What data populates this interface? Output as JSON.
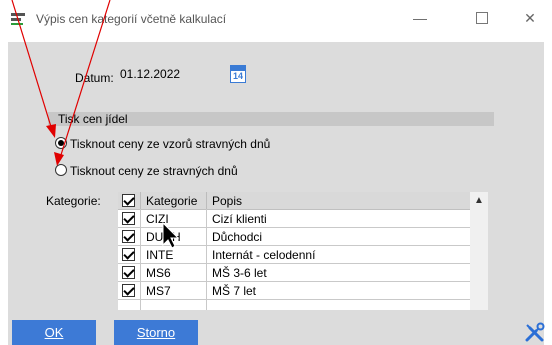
{
  "window": {
    "title": "Výpis cen kategorií včetně kalkulací",
    "minimize": "—",
    "close": "✕"
  },
  "form": {
    "date_label": "Datum:",
    "date_value": "01.12.2022",
    "calendar_icon_text": "14",
    "group_title": "Tisk cen jídel",
    "radio_options": [
      {
        "label": "Tisknout ceny ze vzorů stravných dnů",
        "selected": true
      },
      {
        "label": "Tisknout ceny ze stravných dnů",
        "selected": false
      }
    ],
    "categories_label": "Kategorie:"
  },
  "table": {
    "columns": [
      "Kategorie",
      "Popis"
    ],
    "header_checked": true,
    "rows": [
      {
        "kategorie": "CIZI",
        "popis": "Cizí klienti",
        "checked": true
      },
      {
        "kategorie": "DUCH",
        "popis": "Důchodci",
        "checked": true
      },
      {
        "kategorie": "INTE",
        "popis": "Internát - celodenní",
        "checked": true
      },
      {
        "kategorie": "MS6",
        "popis": "MŠ 3-6 let",
        "checked": true
      },
      {
        "kategorie": "MS7",
        "popis": "MŠ 7 let",
        "checked": true
      }
    ]
  },
  "buttons": {
    "ok": "OK",
    "storno": "Storno"
  },
  "colors": {
    "button_blue": "#3d7ad6",
    "dialog_bg": "#dcdcdc",
    "annotation_red": "#e00000"
  },
  "icons": [
    "app-icon",
    "calendar-icon",
    "tools-icon",
    "mouse-cursor-icon"
  ]
}
